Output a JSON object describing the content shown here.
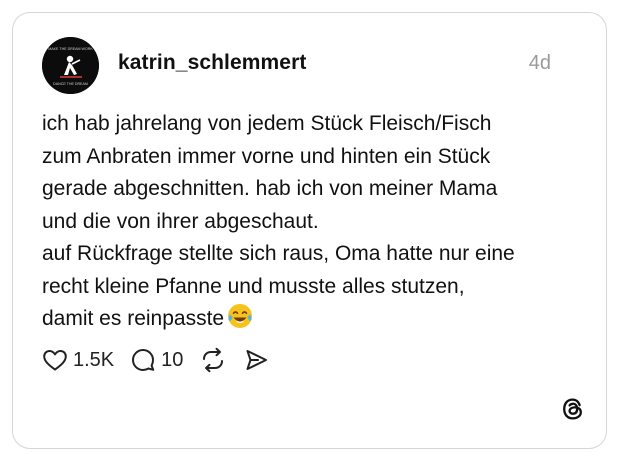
{
  "post": {
    "username": "katrin_schlemmert",
    "timestamp": "4d",
    "text_lines": [
      "ich hab jahrelang von jedem Stück Fleisch/Fisch",
      "zum Anbraten immer vorne und hinten ein Stück",
      "gerade abgeschnitten. hab ich von meiner Mama",
      "und die von ihrer abgeschaut.",
      "auf Rückfrage stellte sich raus, Oma hatte nur eine",
      "recht kleine Pfanne und musste alles stutzen,",
      "damit es reinpasste"
    ],
    "emoji": "face-with-tears-of-joy",
    "avatar_text": "MAKE THE DREAM WORK"
  },
  "actions": {
    "likes": "1.5K",
    "replies": "10"
  },
  "icons": {
    "like": "heart-icon",
    "reply": "comment-icon",
    "repost": "repost-icon",
    "share": "share-icon",
    "brand": "threads-logo-icon"
  },
  "colors": {
    "text": "#111111",
    "muted": "#9a9a9a",
    "border": "#d6d6d6",
    "emoji": "#f7c21b"
  }
}
